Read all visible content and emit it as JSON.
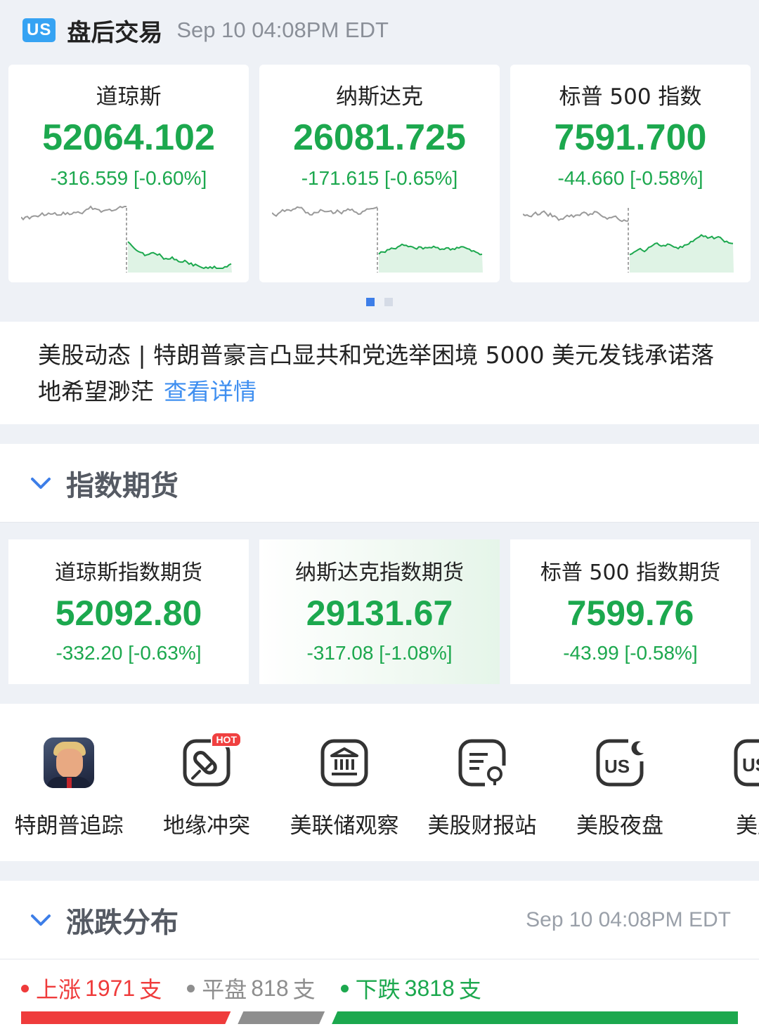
{
  "header": {
    "market_badge": "US",
    "title": "盘后交易",
    "timestamp": "Sep 10 04:08PM EDT"
  },
  "indices": [
    {
      "name": "道琼斯",
      "value": "52064.102",
      "change": "-316.559 [-0.60%]",
      "color": "#1ca84e"
    },
    {
      "name": "纳斯达克",
      "value": "26081.725",
      "change": "-171.615 [-0.65%]",
      "color": "#1ca84e"
    },
    {
      "name": "标普 500 指数",
      "value": "7591.700",
      "change": "-44.660 [-0.58%]",
      "color": "#1ca84e"
    }
  ],
  "carousel": {
    "pages": 2,
    "active": 0
  },
  "news": {
    "text": "美股动态 | 特朗普豪言凸显共和党选举困境 5000 美元发钱承诺落地希望渺茫",
    "link_label": "查看详情"
  },
  "futures_section": {
    "title": "指数期货",
    "items": [
      {
        "name": "道琼斯指数期货",
        "value": "52092.80",
        "change": "-332.20 [-0.63%]"
      },
      {
        "name": "纳斯达克指数期货",
        "value": "29131.67",
        "change": "-317.08 [-1.08%]"
      },
      {
        "name": "标普 500 指数期货",
        "value": "7599.76",
        "change": "-43.99 [-0.58%]"
      }
    ]
  },
  "shortcuts": [
    {
      "label": "特朗普追踪",
      "icon": "trump-avatar-icon"
    },
    {
      "label": "地缘冲突",
      "icon": "missile-icon",
      "badge": "HOT"
    },
    {
      "label": "美联储观察",
      "icon": "bank-icon"
    },
    {
      "label": "美股财报站",
      "icon": "report-icon"
    },
    {
      "label": "美股夜盘",
      "icon": "us-night-icon"
    },
    {
      "label": "美股",
      "icon": "us-icon"
    }
  ],
  "distribution": {
    "title": "涨跌分布",
    "timestamp": "Sep 10 04:08PM EDT",
    "up": {
      "label": "上涨",
      "count": "1971",
      "unit": "支",
      "color": "#ef3b3b"
    },
    "flat": {
      "label": "平盘",
      "count": "818",
      "unit": "支",
      "color": "#8e8e8e"
    },
    "down": {
      "label": "下跌",
      "count": "3818",
      "unit": "支",
      "color": "#1ca84e"
    }
  },
  "colors": {
    "up": "#ef3b3b",
    "down": "#1ca84e",
    "flat": "#8e8e8e",
    "accent": "#3d7ee8",
    "link": "#3f8ff0"
  }
}
